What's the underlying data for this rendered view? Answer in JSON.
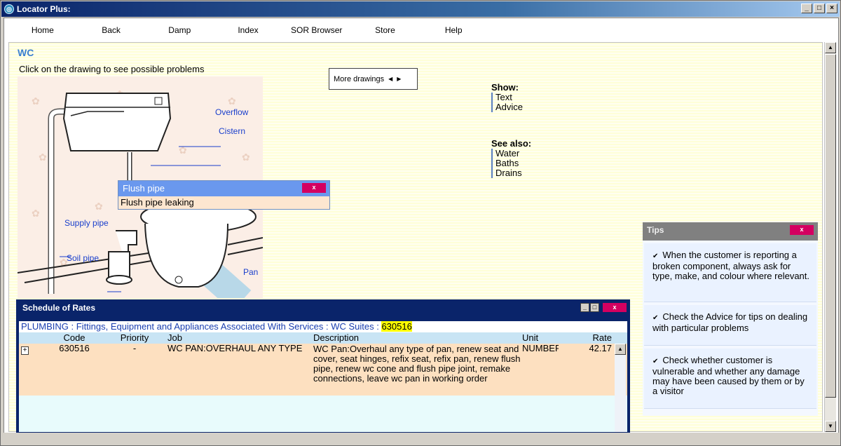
{
  "window": {
    "title": "Locator Plus:",
    "app_icon": "locator-icon"
  },
  "menu": [
    {
      "label": "Home"
    },
    {
      "label": "Back"
    },
    {
      "label": "Damp"
    },
    {
      "label": "Index"
    },
    {
      "label": "SOR Browser"
    },
    {
      "label": "Store"
    },
    {
      "label": "Help"
    }
  ],
  "page": {
    "title": "WC",
    "instruction": "Click on the drawing to see possible problems",
    "more_drawings": "More drawings"
  },
  "drawing_labels": {
    "overflow": "Overflow",
    "cistern": "Cistern",
    "supply_pipe": "Supply pipe",
    "soil_pipe": "Soil pipe",
    "pan": "Pan"
  },
  "popup": {
    "title": "Flush pipe",
    "item": "Flush pipe leaking",
    "close": "x"
  },
  "show": {
    "heading": "Show:",
    "links": [
      "Text",
      "Advice"
    ]
  },
  "see_also": {
    "heading": "See also:",
    "links": [
      "Water",
      "Baths",
      "Drains"
    ]
  },
  "tips": {
    "title": "Tips",
    "close": "x",
    "items": [
      "When the customer is reporting a broken component, always ask for type, make, and colour where relevant.",
      "Check the Advice for tips on dealing with particular problems",
      "Check whether customer is vulnerable and whether any damage may have been caused by them or by a visitor"
    ]
  },
  "sor": {
    "title": "Schedule of Rates",
    "breadcrumb": "PLUMBING : Fittings, Equipment and Appliances Associated With Services : WC Suites :",
    "breadcrumb_code": "630516",
    "columns": {
      "code": "Code",
      "priority": "Priority",
      "job": "Job",
      "description": "Description",
      "unit": "Unit",
      "rate": "Rate"
    },
    "rows": [
      {
        "expand": "+",
        "code": "630516",
        "priority": "-",
        "job": "WC PAN:OVERHAUL ANY TYPE",
        "description": "WC Pan:Overhaul any type of pan, renew seat and cover, seat hinges, refix seat, refix pan, renew flush pipe, renew wc cone and flush pipe joint, remake connections, leave wc pan in working order",
        "unit": "NUMBER",
        "rate": "42.17"
      }
    ]
  },
  "colors": {
    "accent": "#3a7fd0",
    "close": "#d40060",
    "popup_header": "#6a98ee",
    "row_bg": "#fde0c0"
  }
}
